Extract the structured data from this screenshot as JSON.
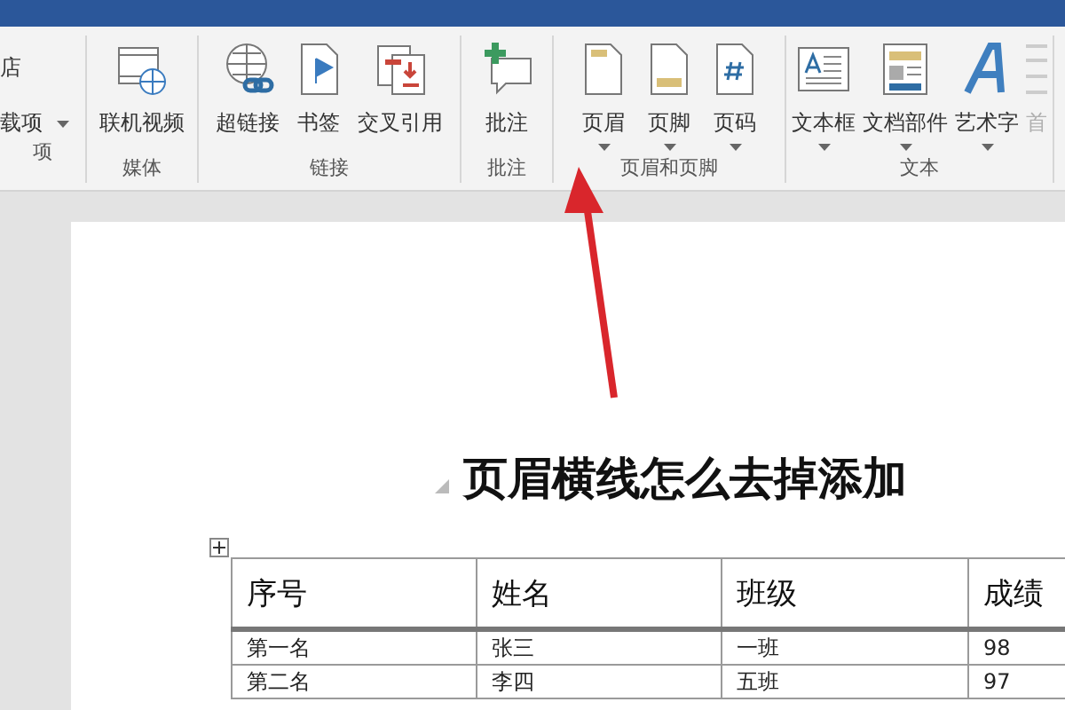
{
  "ribbon": {
    "groups": [
      {
        "label": "项",
        "items": [
          {
            "label": "店",
            "dropdown": false,
            "disabled": false
          },
          {
            "label": "载项",
            "dropdown": true,
            "disabled": false
          }
        ]
      },
      {
        "label": "媒体",
        "items": [
          {
            "label": "联机视频",
            "dropdown": false,
            "disabled": false
          }
        ]
      },
      {
        "label": "链接",
        "items": [
          {
            "label": "超链接",
            "dropdown": false,
            "disabled": false
          },
          {
            "label": "书签",
            "dropdown": false,
            "disabled": false
          },
          {
            "label": "交叉引用",
            "dropdown": false,
            "disabled": false
          }
        ]
      },
      {
        "label": "批注",
        "items": [
          {
            "label": "批注",
            "dropdown": false,
            "disabled": false
          }
        ]
      },
      {
        "label": "页眉和页脚",
        "items": [
          {
            "label": "页眉",
            "dropdown": true,
            "disabled": false
          },
          {
            "label": "页脚",
            "dropdown": true,
            "disabled": false
          },
          {
            "label": "页码",
            "dropdown": true,
            "disabled": false
          }
        ]
      },
      {
        "label": "文本",
        "items": [
          {
            "label": "文本框",
            "dropdown": true,
            "disabled": false
          },
          {
            "label": "文档部件",
            "dropdown": true,
            "disabled": false
          },
          {
            "label": "艺术字",
            "dropdown": true,
            "disabled": false
          },
          {
            "label": "首",
            "dropdown": false,
            "disabled": true
          }
        ]
      }
    ]
  },
  "document": {
    "heading": "页眉横线怎么去掉添加",
    "table": {
      "columns": [
        "序号",
        "姓名",
        "班级",
        "成绩"
      ],
      "rows": [
        [
          "第一名",
          "张三",
          "一班",
          "98"
        ],
        [
          "第二名",
          "李四",
          "五班",
          "97"
        ]
      ]
    }
  }
}
